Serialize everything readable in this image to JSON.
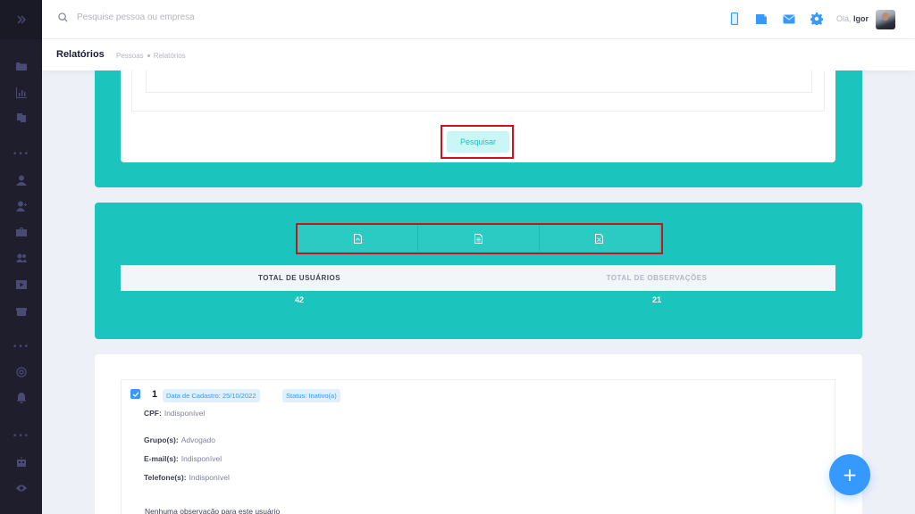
{
  "header": {
    "search_placeholder": "Pesquise pessoa ou empresa",
    "greeting_prefix": "Olá,",
    "user_name": "Igor"
  },
  "subheader": {
    "title": "Relatórios",
    "breadcrumb": [
      "Pessoas",
      "Relatórios"
    ]
  },
  "filters": {
    "search_button": "Pesquisar"
  },
  "summary": {
    "total_users_label": "TOTAL DE USUÁRIOS",
    "total_obs_label": "TOTAL DE OBSERVAÇÕES",
    "total_users": "42",
    "total_obs": "21"
  },
  "user_card": {
    "id": "1",
    "register_badge": "Data de Cadastro: 25/10/2022",
    "status_badge": "Status: Inativo(a)",
    "fields": [
      {
        "label": "CPF:",
        "value": "Indisponível"
      },
      {
        "label": "Grupo(s):",
        "value": "Advogado"
      },
      {
        "label": "E-mail(s):",
        "value": "Indisponível"
      },
      {
        "label": "Telefone(s):",
        "value": "Indisponível"
      }
    ],
    "observation": "Nenhuma observação para este usuário"
  },
  "fab": {
    "label": "+"
  },
  "colors": {
    "sidebar": "#1e1e2d",
    "teal": "#1bc5bd",
    "primary": "#3699ff",
    "highlight": "#d0101b"
  }
}
